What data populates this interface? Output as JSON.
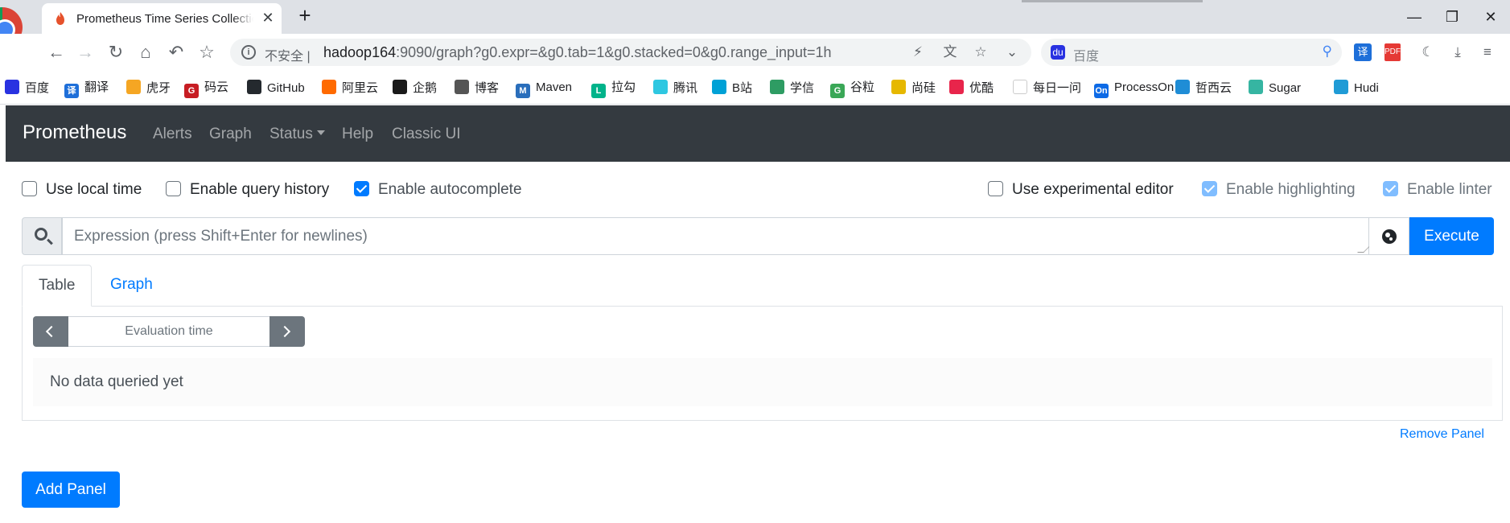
{
  "browser": {
    "tab_title": "Prometheus Time Series Collection and Processing Server",
    "close_glyph": "✕",
    "new_tab_glyph": "+",
    "window_controls": {
      "minimize": "—",
      "restore": "❐",
      "close": "✕"
    },
    "address": {
      "security_label": "不安全 |",
      "host": "hadoop164",
      "path": ":9090/graph?g0.expr=&g0.tab=1&g0.stacked=0&g0.range_input=1h"
    },
    "search": {
      "placeholder": "百度"
    },
    "nav_icons": [
      "back-arrow-icon",
      "forward-arrow-icon",
      "reload-icon",
      "home-icon",
      "undo-icon",
      "star-icon"
    ],
    "bookmarks": [
      {
        "label": "百度",
        "color": "#2932e1",
        "glyph": ""
      },
      {
        "label": "翻译",
        "color": "#1e6fd9",
        "glyph": "译"
      },
      {
        "label": "虎牙",
        "color": "#f5a623",
        "glyph": ""
      },
      {
        "label": "码云",
        "color": "#c71d23",
        "glyph": "G"
      },
      {
        "label": "GitHub",
        "color": "#24292e",
        "glyph": ""
      },
      {
        "label": "阿里云",
        "color": "#ff6a00",
        "glyph": ""
      },
      {
        "label": "企鹅",
        "color": "#1a1a1a",
        "glyph": ""
      },
      {
        "label": "博客",
        "color": "#555555",
        "glyph": ""
      },
      {
        "label": "Maven",
        "color": "#2a6ebb",
        "glyph": "M"
      },
      {
        "label": "拉勾",
        "color": "#00b38a",
        "glyph": "L"
      },
      {
        "label": "腾讯",
        "color": "#2ec7e1",
        "glyph": ""
      },
      {
        "label": "B站",
        "color": "#00a1d6",
        "glyph": ""
      },
      {
        "label": "学信",
        "color": "#2e9c63",
        "glyph": ""
      },
      {
        "label": "谷粒",
        "color": "#3aa757",
        "glyph": "G"
      },
      {
        "label": "尚硅",
        "color": "#e6b800",
        "glyph": ""
      },
      {
        "label": "优酷",
        "color": "#e8254b",
        "glyph": ""
      },
      {
        "label": "每日一问",
        "color": "#ffffff",
        "glyph": ""
      },
      {
        "label": "ProcessOn",
        "color": "#0d6ae6",
        "glyph": "On"
      },
      {
        "label": "哲西云",
        "color": "#1f8dd6",
        "glyph": ""
      },
      {
        "label": "Sugar",
        "color": "#36b5a2",
        "glyph": ""
      },
      {
        "label": "Hudi",
        "color": "#1f9bd6",
        "glyph": ""
      }
    ]
  },
  "app": {
    "brand": "Prometheus",
    "nav": {
      "alerts": "Alerts",
      "graph": "Graph",
      "status": "Status",
      "help": "Help",
      "classic": "Classic UI"
    },
    "options": {
      "use_local_time": "Use local time",
      "enable_query_history": "Enable query history",
      "enable_autocomplete": "Enable autocomplete",
      "use_experimental_editor": "Use experimental editor",
      "enable_highlighting": "Enable highlighting",
      "enable_linter": "Enable linter"
    },
    "expression": {
      "placeholder": "Expression (press Shift+Enter for newlines)",
      "execute": "Execute"
    },
    "tabs": {
      "table": "Table",
      "graph": "Graph"
    },
    "eval_time_placeholder": "Evaluation time",
    "no_data": "No data queried yet",
    "remove_panel": "Remove Panel",
    "add_panel": "Add Panel",
    "colors": {
      "navbar": "#343a40",
      "primary": "#007bff",
      "secondary": "#6c757d"
    }
  }
}
